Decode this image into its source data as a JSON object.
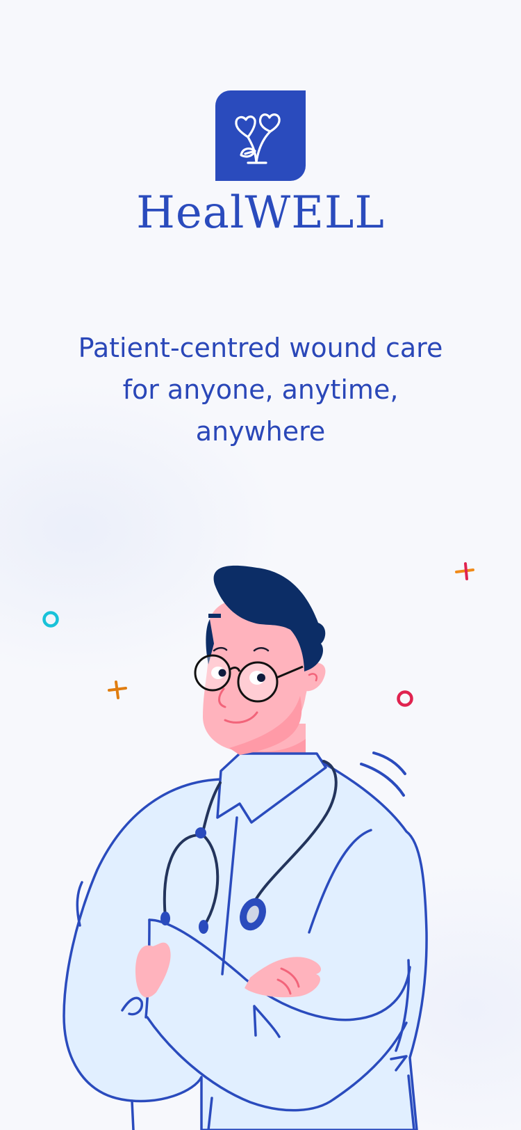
{
  "brand": {
    "name": "HealWELL",
    "logo_icon": "heart-flower-sprout-icon",
    "color": "#2a4bbd"
  },
  "onboarding": {
    "tagline_lines": [
      "Patient-centred wound care",
      "for anyone, anytime,",
      "anywhere"
    ],
    "illustration": "doctor-with-stethoscope-illustration"
  },
  "colors": {
    "background": "#f7f8fc",
    "primary": "#2a4bbd",
    "skin": "#ffb3bd",
    "hair": "#0c2d66",
    "coat": "#e1efff"
  }
}
